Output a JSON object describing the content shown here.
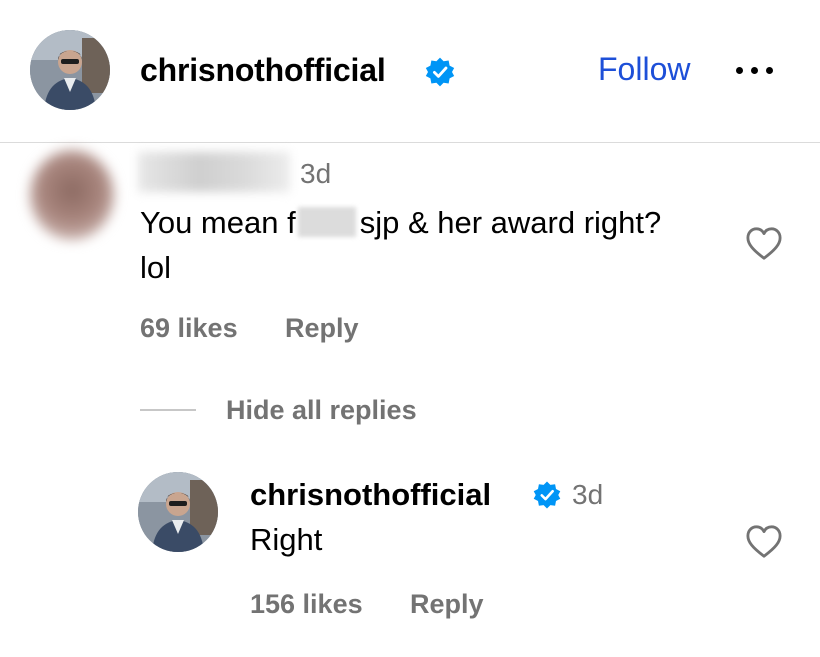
{
  "header": {
    "username": "chrisnothofficial",
    "follow_label": "Follow",
    "more_icon": "more-horizontal-icon",
    "verified_icon": "verified-badge-icon",
    "accent_color": "#1d4fd8",
    "verified_color": "#0095f6"
  },
  "comment": {
    "time": "3d",
    "text_before": "You mean f",
    "text_after": "sjp & her award right? lol",
    "likes": "69 likes",
    "reply_label": "Reply",
    "heart_icon": "heart-outline-icon"
  },
  "thread": {
    "hide_replies_label": "Hide all replies"
  },
  "reply": {
    "username": "chrisnothofficial",
    "time": "3d",
    "text": "Right",
    "likes": "156 likes",
    "reply_label": "Reply",
    "heart_icon": "heart-outline-icon"
  }
}
